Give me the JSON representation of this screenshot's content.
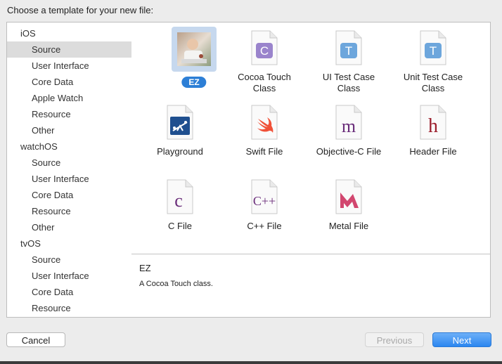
{
  "dialog": {
    "heading": "Choose a template for your new file:"
  },
  "sidebar": {
    "groups": [
      {
        "platform": "iOS",
        "items": [
          "Source",
          "User Interface",
          "Core Data",
          "Apple Watch",
          "Resource",
          "Other"
        ]
      },
      {
        "platform": "watchOS",
        "items": [
          "Source",
          "User Interface",
          "Core Data",
          "Resource",
          "Other"
        ]
      },
      {
        "platform": "tvOS",
        "items": [
          "Source",
          "User Interface",
          "Core Data",
          "Resource"
        ]
      }
    ],
    "selected": "iOS / Source"
  },
  "templates": [
    {
      "label": "EZ",
      "icon": "photo-thumbnail-icon",
      "selected": true
    },
    {
      "label": "Cocoa Touch\nClass",
      "icon": "cocoa-touch-class-icon",
      "glyph": "C",
      "color": "#8b6fc3"
    },
    {
      "label": "UI Test Case\nClass",
      "icon": "ui-test-case-class-icon",
      "glyph": "T",
      "color": "#5a9bd8"
    },
    {
      "label": "Unit Test Case\nClass",
      "icon": "unit-test-case-class-icon",
      "glyph": "T",
      "color": "#5a9bd8"
    },
    {
      "label": "Playground",
      "icon": "playground-icon"
    },
    {
      "label": "Swift File",
      "icon": "swift-file-icon"
    },
    {
      "label": "Objective-C File",
      "icon": "objective-c-file-icon",
      "glyph": "m",
      "color": "#6a2d7a"
    },
    {
      "label": "Header File",
      "icon": "header-file-icon",
      "glyph": "h",
      "color": "#9c1e2c"
    },
    {
      "label": "C File",
      "icon": "c-file-icon",
      "glyph": "c",
      "color": "#6a2d7a"
    },
    {
      "label": "C++ File",
      "icon": "cpp-file-icon",
      "glyph": "C++",
      "color": "#6a2d7a"
    },
    {
      "label": "Metal File",
      "icon": "metal-file-icon"
    }
  ],
  "description": {
    "title": "EZ",
    "text": "A Cocoa Touch class."
  },
  "buttons": {
    "cancel": "Cancel",
    "previous": "Previous",
    "next": "Next"
  }
}
